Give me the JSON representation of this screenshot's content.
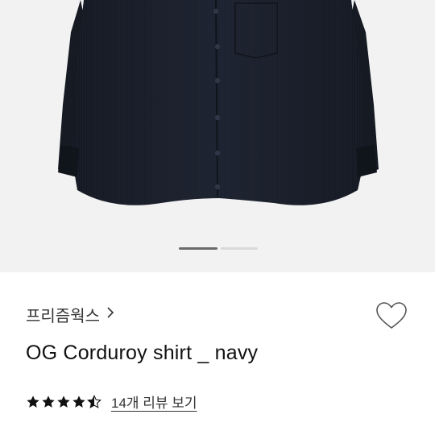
{
  "product": {
    "brand": "프리즘웍스",
    "name": "OG Corduroy shirt _ navy",
    "rating": 4.5,
    "rating_max": 5,
    "review_link": "14개 리뷰 보기"
  },
  "gallery": {
    "active_index": 0,
    "image_description": "dark navy corduroy shirt"
  },
  "icons": {
    "brand_chevron": "chevron-right-icon",
    "wishlist": "heart-outline-icon",
    "star": "star-icon"
  },
  "colors": {
    "image_background": "#f2f2f2",
    "shirt": "#1a1f2a",
    "pager_active": "#6b6b6b",
    "pager_inactive": "#d9d9d9"
  }
}
